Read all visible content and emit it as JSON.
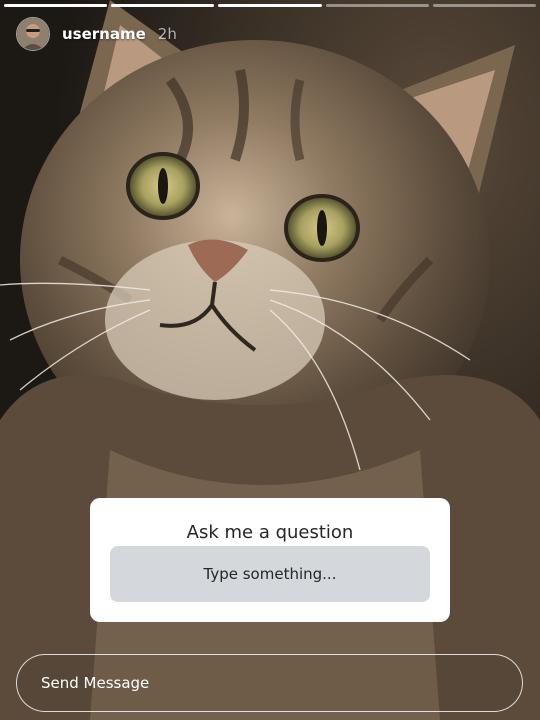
{
  "story": {
    "progress_segments": [
      {
        "state": "done"
      },
      {
        "state": "done"
      },
      {
        "state": "done"
      },
      {
        "state": "pending"
      },
      {
        "state": "pending"
      }
    ]
  },
  "header": {
    "username": "username",
    "time": "2h"
  },
  "question_sticker": {
    "title": "Ask me a question",
    "placeholder": "Type something..."
  },
  "message_bar": {
    "placeholder": "Send Message"
  },
  "colors": {
    "card_background": "#ffffff",
    "input_background": "#d4d7dc",
    "text_dark": "#262626",
    "text_light": "#ffffff"
  }
}
